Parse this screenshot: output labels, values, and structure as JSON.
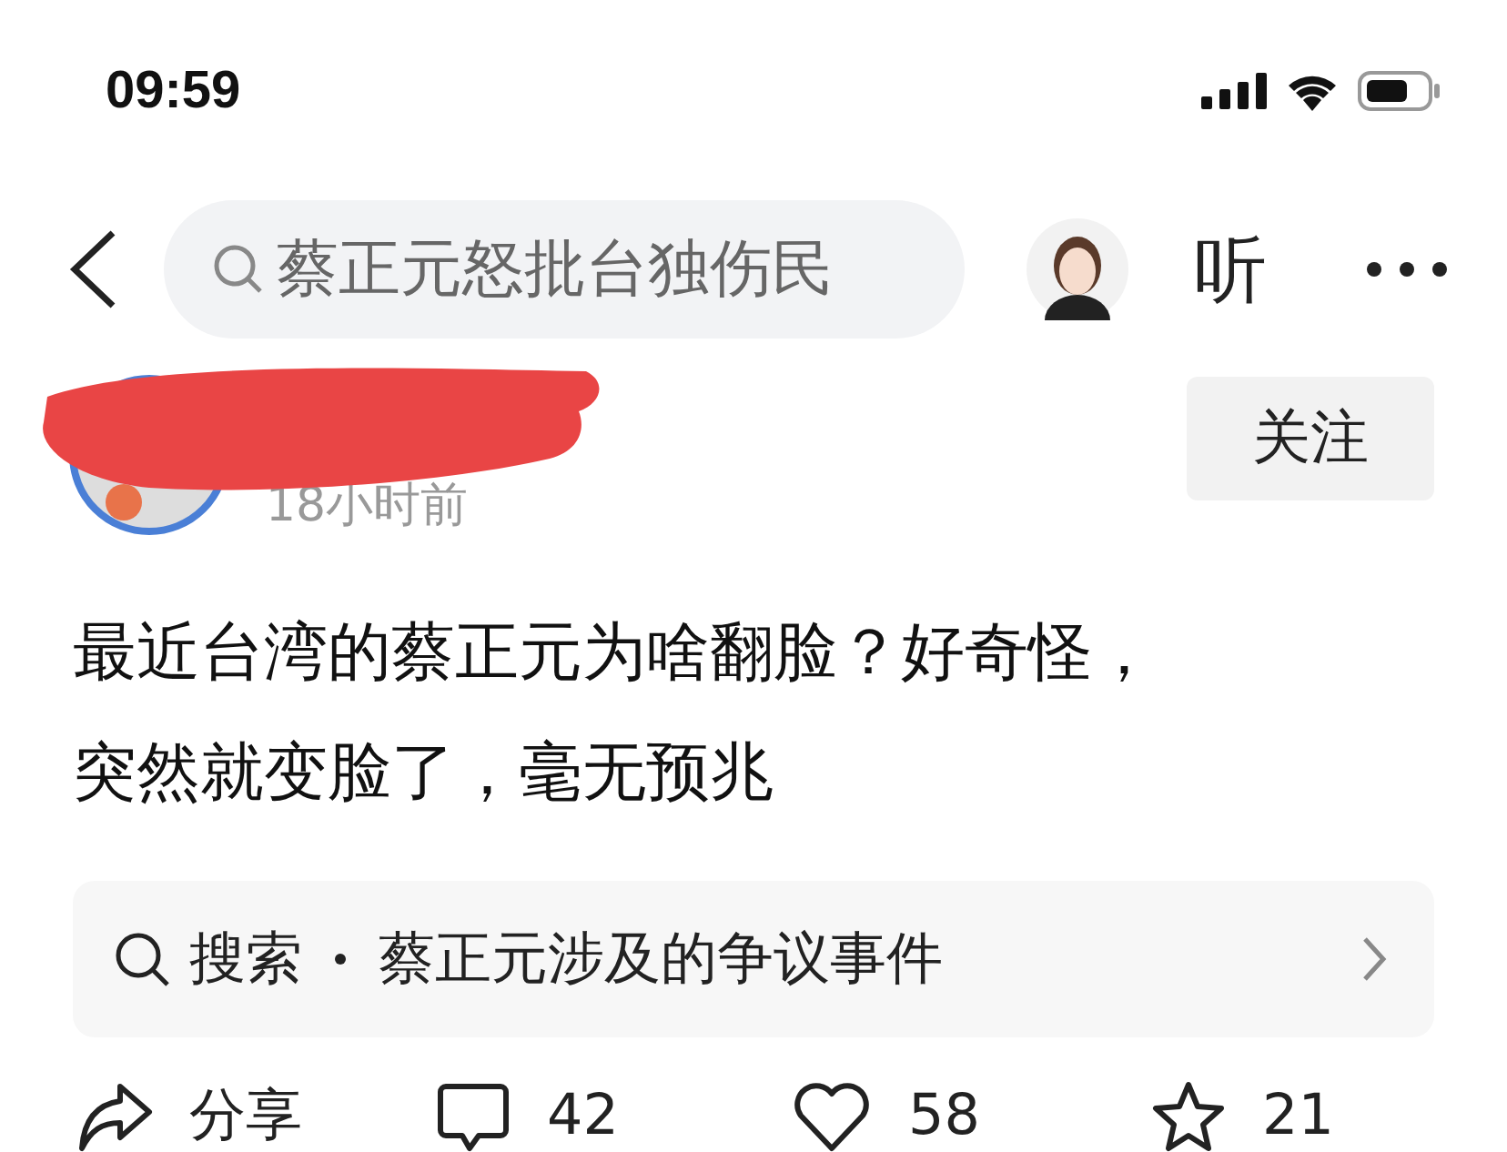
{
  "status_bar": {
    "time": "09:59"
  },
  "nav": {
    "search_text": "蔡正元怒批台独伤民",
    "listen": "听"
  },
  "author": {
    "redacted": true,
    "time": "18小时前",
    "follow": "关注"
  },
  "post": {
    "lines": [
      "最近台湾的蔡正元为啥翻脸？好奇怪，",
      "突然就变脸了，毫无预兆"
    ]
  },
  "related_search": {
    "label": "搜索",
    "topic": "蔡正元涉及的争议事件"
  },
  "actions": [
    {
      "kind": "share",
      "text": "分享"
    },
    {
      "kind": "comment",
      "text": "42"
    },
    {
      "kind": "like",
      "text": "58"
    },
    {
      "kind": "star",
      "text": "21"
    }
  ]
}
